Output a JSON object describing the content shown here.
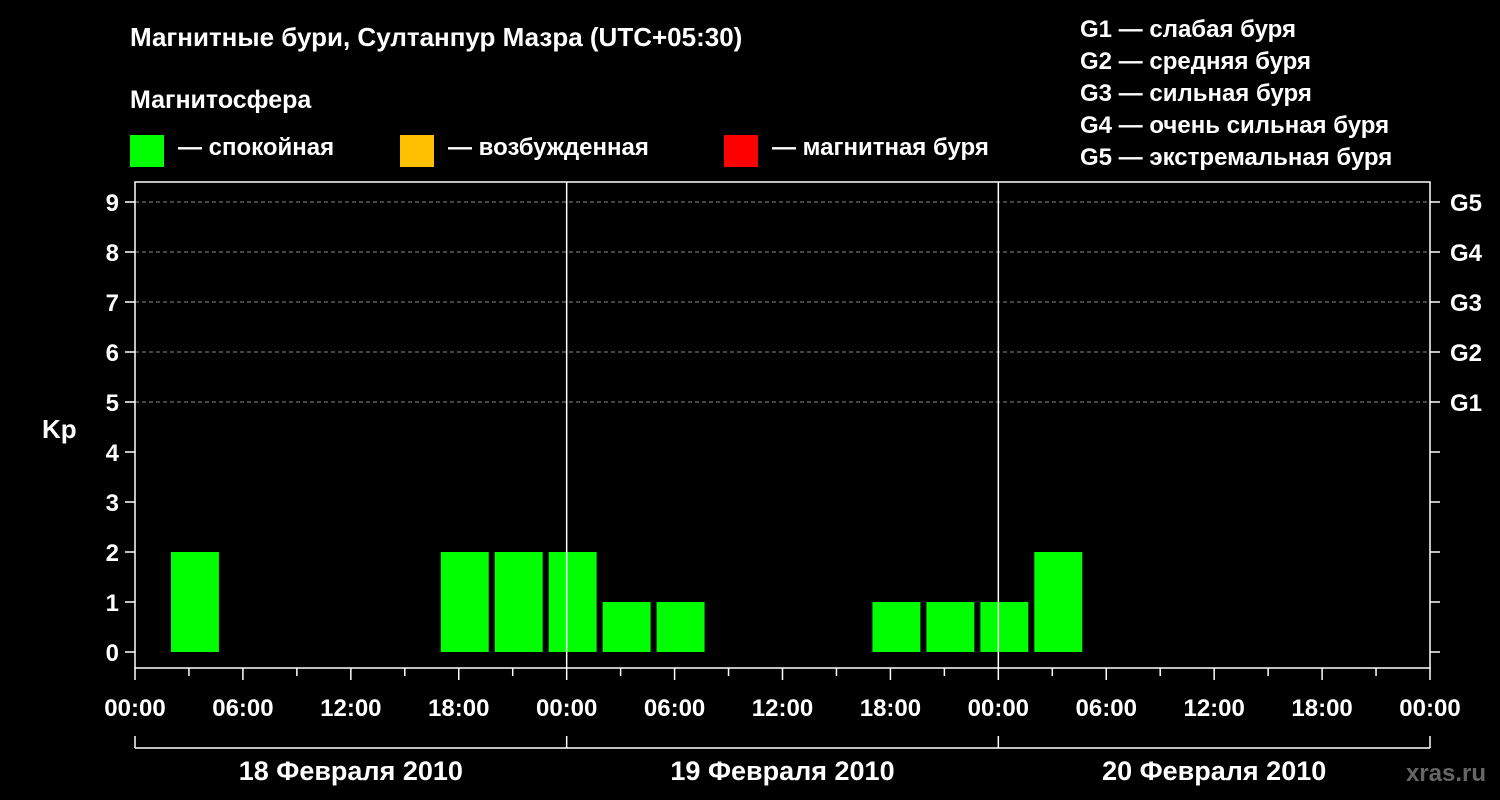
{
  "header": {
    "title": "Магнитные бури, Султанпур Мазра (UTC+05:30)",
    "magnetosphere_label": "Магнитосфера"
  },
  "legend": [
    {
      "label": "— спокойная",
      "color": "#00ff00"
    },
    {
      "label": "— возбужденная",
      "color": "#ffc000"
    },
    {
      "label": "— магнитная буря",
      "color": "#ff0000"
    }
  ],
  "g_scale": [
    "G1 — слабая буря",
    "G2 — средняя буря",
    "G3 — сильная буря",
    "G4 — очень сильная буря",
    "G5 — экстремальная буря"
  ],
  "watermark": "xras.ru",
  "chart_data": {
    "type": "bar",
    "ylabel": "Kp",
    "ylim": [
      0,
      9
    ],
    "y_ticks": [
      "0",
      "1",
      "2",
      "3",
      "4",
      "5",
      "6",
      "7",
      "8",
      "9"
    ],
    "right_axis_labels": [
      {
        "kp": 5,
        "label": "G1"
      },
      {
        "kp": 6,
        "label": "G2"
      },
      {
        "kp": 7,
        "label": "G3"
      },
      {
        "kp": 8,
        "label": "G4"
      },
      {
        "kp": 9,
        "label": "G5"
      }
    ],
    "x_tick_labels": [
      "00:00",
      "06:00",
      "12:00",
      "18:00",
      "00:00",
      "06:00",
      "12:00",
      "18:00",
      "00:00",
      "06:00",
      "12:00",
      "18:00",
      "00:00"
    ],
    "days": [
      "18 Февраля 2010",
      "19 Февраля 2010",
      "20 Февраля 2010"
    ],
    "interval_hours": 3,
    "x_start_hours": 2,
    "bars": [
      2,
      0,
      0,
      0,
      0,
      2,
      2,
      2,
      1,
      1,
      0,
      0,
      0,
      1,
      1,
      1,
      2,
      0,
      0,
      0,
      0,
      0,
      0,
      0
    ],
    "grid": "dashed at Kp 5-9",
    "colors": {
      "quiet": "#00ff00",
      "active": "#ffc000",
      "storm": "#ff0000"
    }
  }
}
